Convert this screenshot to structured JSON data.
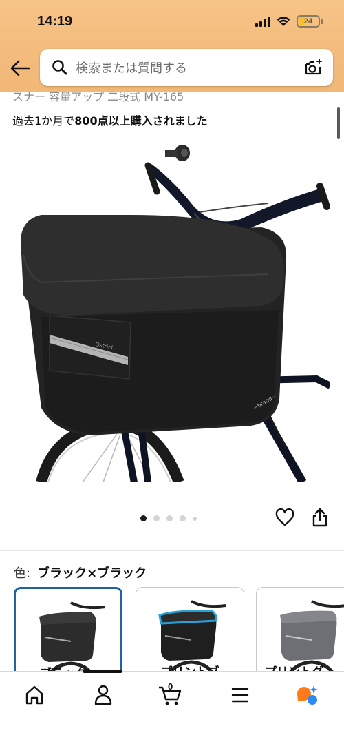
{
  "status_bar": {
    "time": "14:19",
    "battery_level": "24"
  },
  "search": {
    "placeholder": "検索または質問する"
  },
  "product": {
    "title_partial": "スナー 容量アップ 二段式 MY-165",
    "purchase_prefix": "過去1か月で",
    "purchase_bold": "800点以上購入されました",
    "image_count": 5,
    "active_image_index": 0
  },
  "variation": {
    "label": "色:",
    "selected_value": "ブラック×ブラック",
    "swatches": [
      {
        "label": "ブラック×",
        "selected": true,
        "accent": "#3b3b3b"
      },
      {
        "label": "プリントブ",
        "selected": false,
        "accent": "#2aa0d8"
      },
      {
        "label": "プリントグ",
        "selected": false,
        "accent": "#7a7a80"
      }
    ]
  },
  "bottom_nav": {
    "items": [
      {
        "icon": "home-icon"
      },
      {
        "icon": "account-icon"
      },
      {
        "icon": "cart-icon",
        "count": "0"
      },
      {
        "icon": "menu-icon"
      },
      {
        "icon": "rufus-ai-icon"
      }
    ],
    "cart_count": "0"
  },
  "colors": {
    "header_bg": "#f3bb7c",
    "selected_border": "#2162a1",
    "ai_orange": "#ff7a1a",
    "ai_blue": "#2a8cf0"
  }
}
